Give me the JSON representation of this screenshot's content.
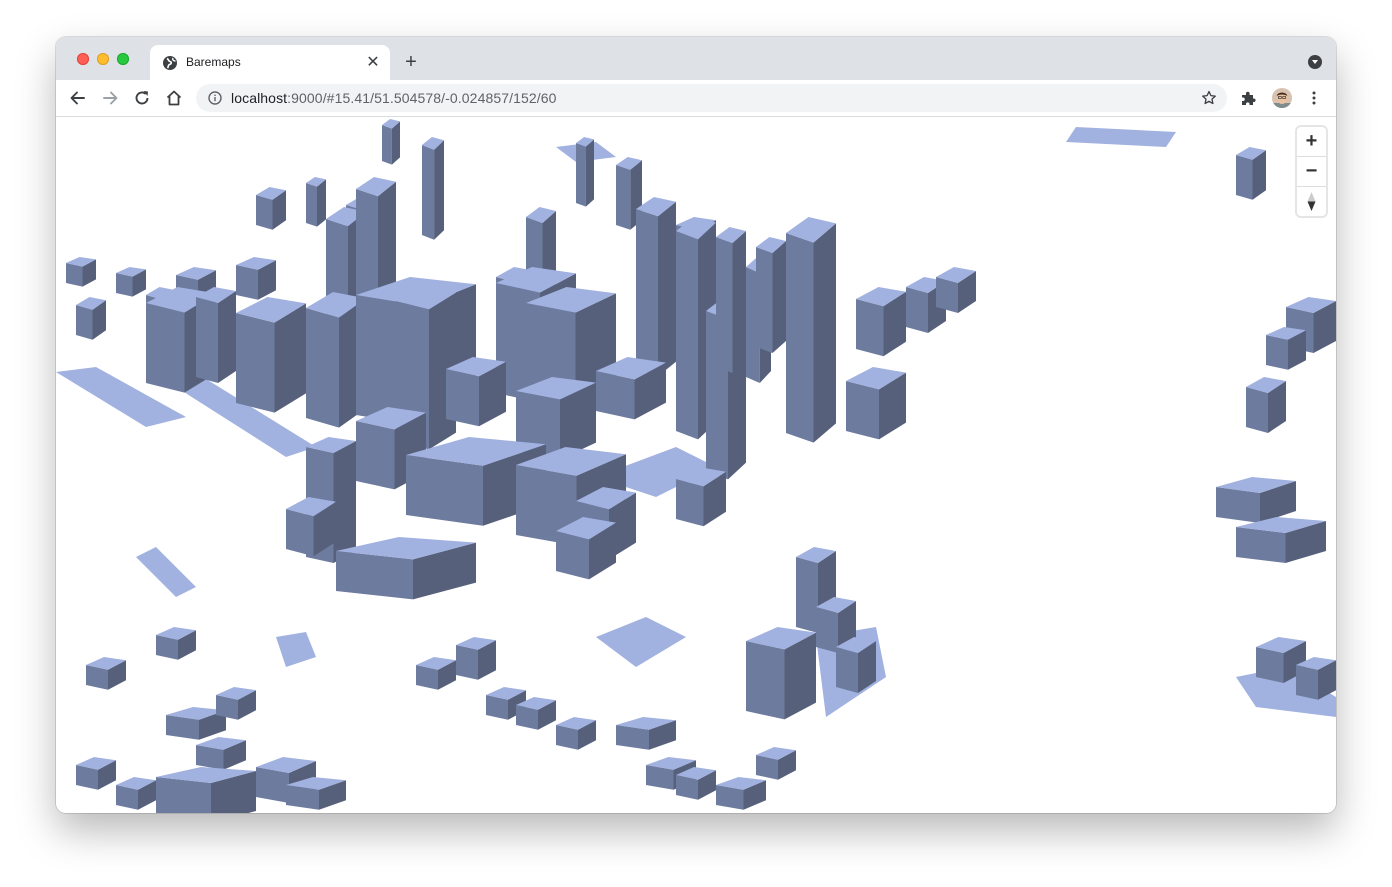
{
  "browser": {
    "tab": {
      "title": "Baremaps",
      "favicon": "globe-icon",
      "close_label": "✕"
    },
    "new_tab_label": "+",
    "address": {
      "host": "localhost",
      "rest": ":9000/#15.41/51.504578/-0.024857/152/60",
      "info_icon": "info-icon",
      "star_icon": "star-icon"
    },
    "nav_icons": [
      "back-arrow-icon",
      "forward-arrow-icon",
      "reload-icon",
      "home-icon"
    ],
    "extensions_icon": "puzzle-icon",
    "menu_icon": "kebab-menu-icon"
  },
  "map": {
    "building_colors": {
      "roof": "#a1b1e0",
      "wall_left": "#6d7b9f",
      "wall_right": "#56607a"
    },
    "controls": {
      "zoom_in": "+",
      "zoom_out": "−",
      "compass": "compass-icon"
    }
  }
}
